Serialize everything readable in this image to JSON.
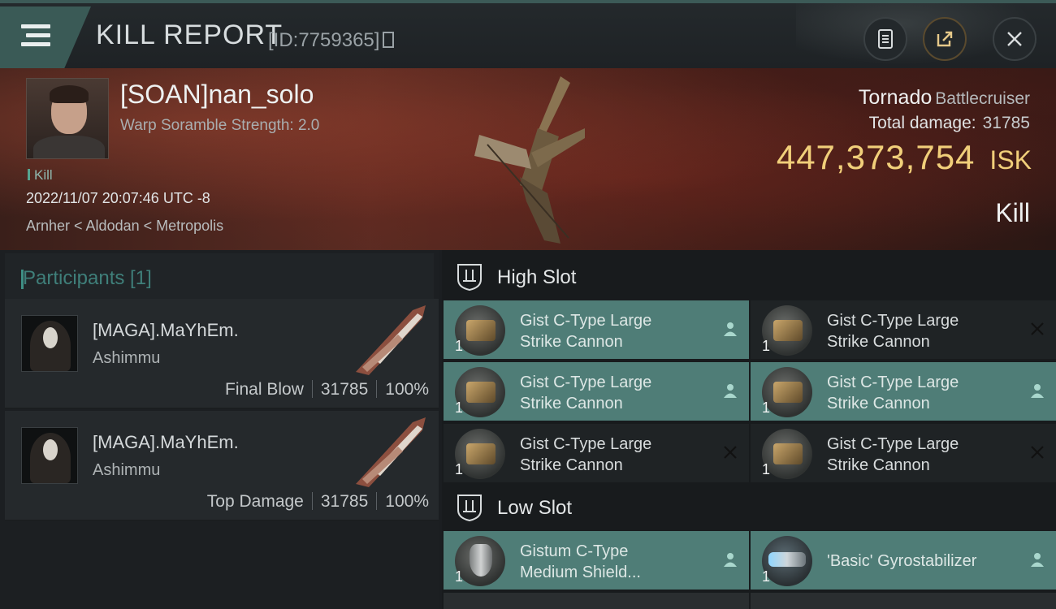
{
  "header": {
    "title": "KILL REPORT",
    "id_label": "[ID:7759365]"
  },
  "victim": {
    "name": "[SOAN]nan_solo",
    "subtitle": "Warp Soramble Strength: 2.0",
    "tag": "Kill",
    "datetime": "2022/11/07 20:07:46 UTC -8",
    "location": "Arnher < Aldodan < Metropolis"
  },
  "ship": {
    "name": "Tornado",
    "class": "Battlecruiser",
    "total_damage_label": "Total damage:",
    "total_damage": "31785",
    "isk_value": "447,373,754",
    "isk_unit": "ISK",
    "result": "Kill"
  },
  "participants": {
    "title": "Participants [1]",
    "list": [
      {
        "name": "[MAGA].MaYhEm.",
        "ship": "Ashimmu",
        "role": "Final Blow",
        "damage": "31785",
        "percent": "100%"
      },
      {
        "name": "[MAGA].MaYhEm.",
        "ship": "Ashimmu",
        "role": "Top Damage",
        "damage": "31785",
        "percent": "100%"
      }
    ]
  },
  "slots": {
    "high": {
      "title": "High Slot",
      "modules": [
        {
          "line1": "Gist C-Type Large",
          "line2": "Strike Cannon",
          "qty": "1",
          "status": "fitted"
        },
        {
          "line1": "Gist C-Type Large",
          "line2": "Strike Cannon",
          "qty": "1",
          "status": "destroyed"
        },
        {
          "line1": "Gist C-Type Large",
          "line2": "Strike Cannon",
          "qty": "1",
          "status": "fitted"
        },
        {
          "line1": "Gist C-Type Large",
          "line2": "Strike Cannon",
          "qty": "1",
          "status": "fitted"
        },
        {
          "line1": "Gist C-Type Large",
          "line2": "Strike Cannon",
          "qty": "1",
          "status": "destroyed"
        },
        {
          "line1": "Gist C-Type Large",
          "line2": "Strike Cannon",
          "qty": "1",
          "status": "destroyed"
        }
      ]
    },
    "low": {
      "title": "Low Slot",
      "modules": [
        {
          "line1": "Gistum C-Type",
          "line2": "Medium Shield...",
          "qty": "1",
          "status": "fitted"
        },
        {
          "line1": "'Basic' Gyrostabilizer",
          "line2": "",
          "qty": "1",
          "status": "fitted"
        }
      ]
    }
  },
  "colors": {
    "accent_teal": "#4f7d77",
    "isk_gold": "#f1cf7a",
    "participants_title": "#3f7f7a"
  },
  "icons": {
    "menu": "hamburger-icon",
    "report": "clipboard-icon",
    "share": "share-icon",
    "close": "close-icon",
    "fitted": "pilot-icon",
    "destroyed": "x-icon",
    "slot": "slot-shield-icon"
  }
}
